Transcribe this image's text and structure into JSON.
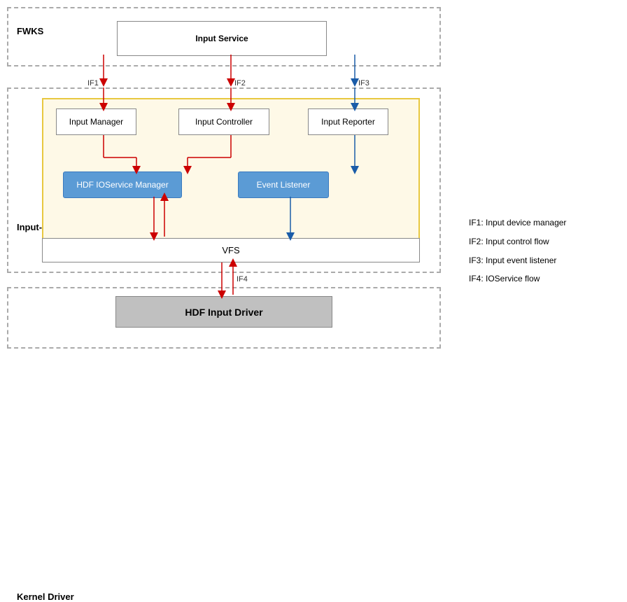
{
  "diagram": {
    "fwks": {
      "label": "FWKS",
      "input_service": "Input Service"
    },
    "hdi": {
      "label": "Input-HDI",
      "components": {
        "input_manager": "Input Manager",
        "input_controller": "Input Controller",
        "input_reporter": "Input Reporter",
        "hdf_ioservice": "HDF IOService Manager",
        "event_listener": "Event Listener"
      },
      "vfs": "VFS"
    },
    "kernel": {
      "label": "Kernel Driver",
      "hdf_driver": "HDF Input Driver"
    },
    "interfaces": {
      "if1_label": "IF1",
      "if2_label": "IF2",
      "if3_label": "IF3",
      "if4_label": "IF4"
    }
  },
  "legend": {
    "items": [
      {
        "id": "IF1",
        "text": "IF1: Input device manager"
      },
      {
        "id": "IF2",
        "text": "IF2: Input control flow"
      },
      {
        "id": "IF3",
        "text": "IF3: Input event listener"
      },
      {
        "id": "IF4",
        "text": "IF4:  IOService flow"
      }
    ]
  }
}
